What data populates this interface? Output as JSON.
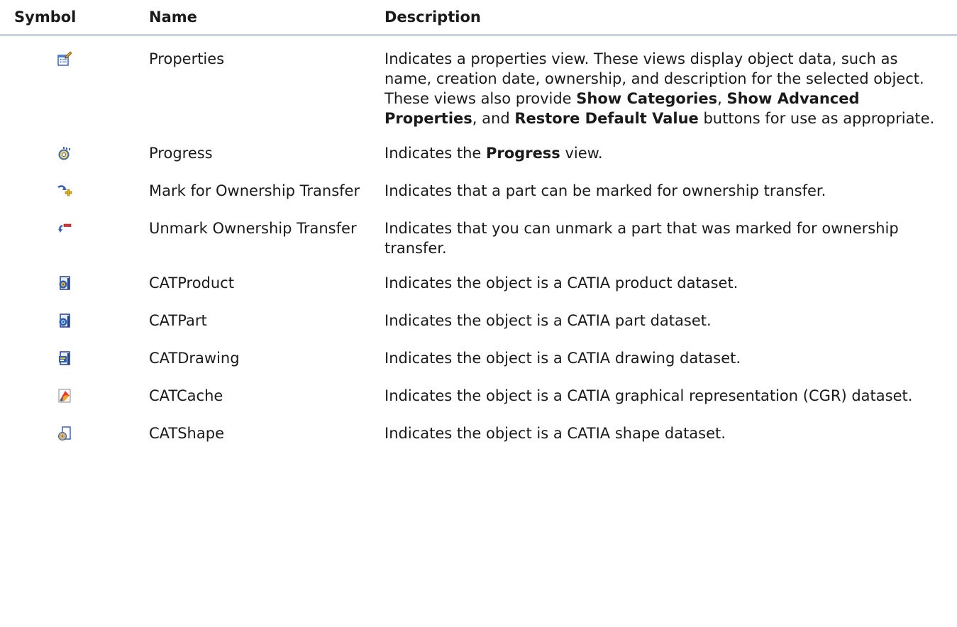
{
  "header": {
    "symbol": "Symbol",
    "name": "Name",
    "description": "Description"
  },
  "rows": [
    {
      "icon": "properties-icon",
      "name": "Properties",
      "description": {
        "part1": "Indicates a properties view. These views display object data, such as name, creation date, ownership, and description for the selected object. These views also provide ",
        "bold1": "Show Categories",
        "part2": ", ",
        "bold2": "Show Advanced Properties",
        "part3": ", and ",
        "bold3": "Restore Default Value",
        "part4": " buttons for use as appropriate."
      }
    },
    {
      "icon": "progress-icon",
      "name": "Progress",
      "description": {
        "part1": "Indicates the ",
        "bold1": "Progress",
        "part2": " view."
      }
    },
    {
      "icon": "mark-ownership-transfer-icon",
      "name": "Mark for Ownership Transfer",
      "description": "Indicates that a part can be marked for ownership transfer."
    },
    {
      "icon": "unmark-ownership-transfer-icon",
      "name": "Unmark Ownership Transfer",
      "description": "Indicates that you can unmark a part that was marked for ownership transfer."
    },
    {
      "icon": "catproduct-icon",
      "name": "CATProduct",
      "description": "Indicates the object is a CATIA product dataset."
    },
    {
      "icon": "catpart-icon",
      "name": "CATPart",
      "description": "Indicates the object is a CATIA part dataset."
    },
    {
      "icon": "catdrawing-icon",
      "name": "CATDrawing",
      "description": "Indicates the object is a CATIA drawing dataset."
    },
    {
      "icon": "catcache-icon",
      "name": "CATCache",
      "description": "Indicates the object is a CATIA graphical representation (CGR) dataset."
    },
    {
      "icon": "catshape-icon",
      "name": "CATShape",
      "description": "Indicates the object is a CATIA shape dataset."
    }
  ]
}
